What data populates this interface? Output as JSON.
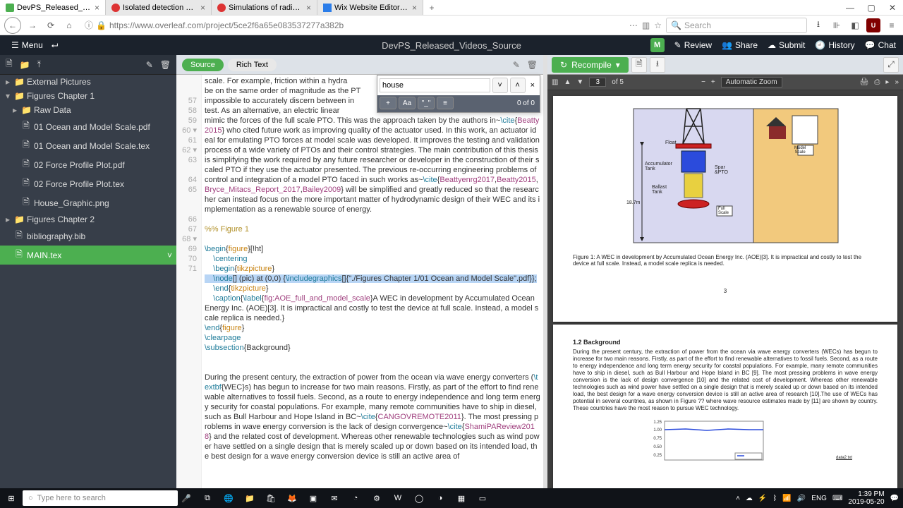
{
  "browser": {
    "tabs": [
      {
        "label": "DevPS_Released_Videos_Sour",
        "active": true
      },
      {
        "label": "Isolated detection of elastic w"
      },
      {
        "label": "Simulations of radiation press"
      },
      {
        "label": "Wix Website Editor - mysite"
      }
    ],
    "url": "https://www.overleaf.com/project/5ce2f6a65e083537277a382b",
    "search_ph": "Search"
  },
  "app": {
    "menu": "Menu",
    "title": "DevPS_Released_Videos_Source",
    "user": "M",
    "actions": {
      "review": "Review",
      "share": "Share",
      "submit": "Submit",
      "history": "History",
      "chat": "Chat"
    }
  },
  "tree": [
    {
      "t": "folder",
      "d": 0,
      "label": "External Pictures"
    },
    {
      "t": "folder",
      "d": 0,
      "label": "Figures Chapter 1",
      "open": true
    },
    {
      "t": "folder",
      "d": 1,
      "label": "Raw Data"
    },
    {
      "t": "file",
      "d": 1,
      "label": "01 Ocean and Model Scale.pdf"
    },
    {
      "t": "file",
      "d": 1,
      "label": "01 Ocean and Model Scale.tex"
    },
    {
      "t": "file",
      "d": 1,
      "label": "02 Force Profile Plot.pdf"
    },
    {
      "t": "file",
      "d": 1,
      "label": "02 Force Profile Plot.tex"
    },
    {
      "t": "file",
      "d": 1,
      "label": "House_Graphic.png"
    },
    {
      "t": "folder",
      "d": 0,
      "label": "Figures Chapter 2"
    },
    {
      "t": "file",
      "d": 0,
      "label": "bibliography.bib"
    },
    {
      "t": "file",
      "d": 0,
      "label": "MAIN.tex",
      "active": true
    }
  ],
  "editor": {
    "tabs": {
      "source": "Source",
      "rich": "Rich Text"
    },
    "find": {
      "value": "house",
      "count": "0 of 0",
      "opts": [
        "Aa",
        "\"_\"",
        "≡"
      ]
    }
  },
  "gutter": [
    "",
    "",
    "57",
    "58",
    "59",
    "60 ▾",
    "61",
    "62 ▾",
    "63",
    "",
    "64",
    "65",
    "",
    "",
    "66",
    "67",
    "68 ▾",
    "69",
    "70",
    "71",
    "",
    "",
    "",
    "",
    "",
    "",
    "",
    ""
  ],
  "recompile": "Recompile",
  "pdf": {
    "page": "3",
    "total": "of 5",
    "zoom": "Automatic Zoom",
    "caption": "Figure 1: A WEC in development by Accumulated Ocean Energy Inc. (AOE)[3]. It is impractical and costly to test the device at full scale. Instead, a model scale replica is needed.",
    "pagenum": "3",
    "section": "1.2   Background",
    "body": "During the present century, the extraction of power from the ocean via wave energy converters (WECs) has begun to increase for two main reasons. Firstly, as part of the effort to find renewable alternatives to fossil fuels. Second, as a route to energy independence and long term energy security for coastal populations. For example, many remote communities have to ship in diesel, such as Bull Harbour and Hope Island in BC [9]. The most pressing problems in wave energy conversion is the lack of design convergence [10] and the related cost of development. Whereas other renewable technologies such as wind power have settled on a single design that is merely scaled up or down based on its intended load, the best design for a wave energy conversion device is still an active area of research [10].The use of WECs has potential in several countries, as shown in Figure ?? where wave resource estimates made by [11] are shown by country. These countries have the most reason to pursue WEC technology.",
    "fig_labels": {
      "float": "Float",
      "accum": "Accumulator\nTank",
      "ballast": "Ballast\nTank",
      "spar": "Spar\n&PTO",
      "height": "18.7m",
      "model": "Model\nScale",
      "full": "Full\nScale"
    }
  },
  "taskbar": {
    "search": "Type here to search",
    "lang": "ENG",
    "time": "1:39 PM",
    "date": "2019-05-20"
  },
  "chart_data": {
    "type": "line",
    "x": [
      0,
      1,
      2,
      3,
      4
    ],
    "values": [
      1.0,
      1.02,
      0.99,
      1.01,
      1.0
    ],
    "ylim": [
      0.25,
      1.25
    ],
    "yticks": [
      0.25,
      0.5,
      0.75,
      1.0,
      1.25
    ],
    "legend": "data2.txt"
  }
}
